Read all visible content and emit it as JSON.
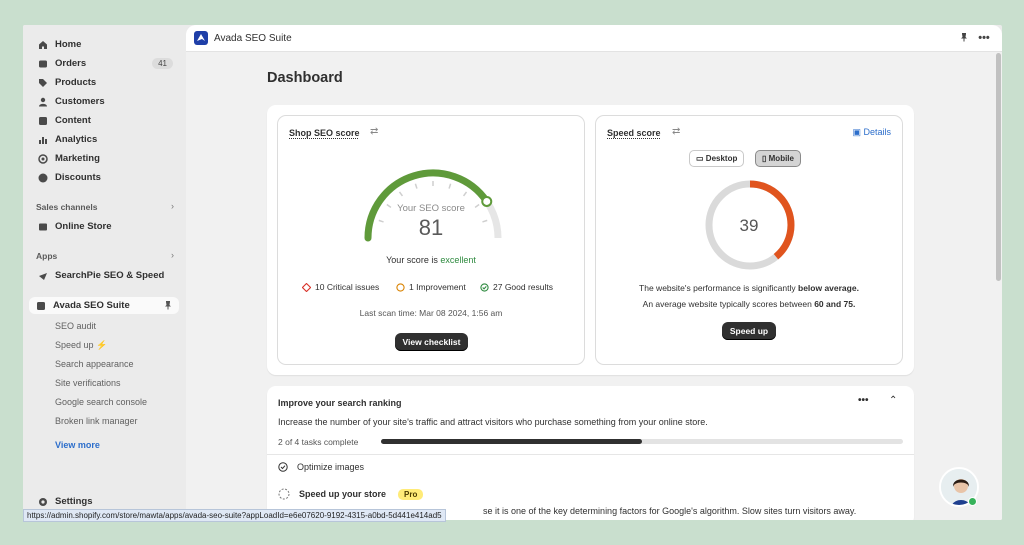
{
  "sidebar": {
    "items": [
      {
        "label": "Home",
        "icon": "home-icon"
      },
      {
        "label": "Orders",
        "icon": "orders-icon",
        "badge": "41"
      },
      {
        "label": "Products",
        "icon": "tag-icon"
      },
      {
        "label": "Customers",
        "icon": "person-icon"
      },
      {
        "label": "Content",
        "icon": "content-icon"
      },
      {
        "label": "Analytics",
        "icon": "bar-chart-icon"
      },
      {
        "label": "Marketing",
        "icon": "target-icon"
      },
      {
        "label": "Discounts",
        "icon": "discount-icon"
      }
    ],
    "sales_channels_title": "Sales channels",
    "online_store": "Online Store",
    "apps_title": "Apps",
    "searchpie": "SearchPie SEO & Speed",
    "active_app": "Avada SEO Suite",
    "sub_items": [
      "SEO audit",
      "Speed up ⚡",
      "Search appearance",
      "Site verifications",
      "Google search console",
      "Broken link manager"
    ],
    "view_more": "View more",
    "settings": "Settings"
  },
  "topbar": {
    "title": "Avada SEO Suite"
  },
  "page_title": "Dashboard",
  "seo": {
    "heading": "Shop SEO score",
    "gauge_label": "Your SEO score",
    "score": "81",
    "score_fraction": 0.81,
    "score_text_prefix": "Your score is",
    "score_text_value": "excellent",
    "critical": "10 Critical issues",
    "improvement": "1 Improvement",
    "good": "27 Good results",
    "last_scan": "Last scan time: Mar 08 2024, 1:56 am",
    "button": "View checklist"
  },
  "speed": {
    "heading": "Speed score",
    "details": "Details",
    "desktop": "Desktop",
    "mobile": "Mobile",
    "score": "39",
    "score_fraction": 0.39,
    "line1_prefix": "The website's performance is significantly",
    "line1_bold": "below average.",
    "line2_prefix": "An average website typically scores between",
    "line2_bold": "60 and 75.",
    "button": "Speed up"
  },
  "improve": {
    "title": "Improve your search ranking",
    "description": "Increase the number of your site's traffic and attract visitors who purchase something from your online store.",
    "tasks_complete": "2 of 4 tasks complete",
    "progress_fraction": 0.5,
    "task1": "Optimize images",
    "task2": "Speed up your store",
    "pro": "Pro",
    "task_desc": "se it is one of the key determining factors for Google's algorithm. Slow sites turn visitors away."
  },
  "status_url": "https://admin.shopify.com/store/mawta/apps/avada-seo-suite?appLoadId=e6e07620-9192-4315-a0bd-5d441e414ad5",
  "colors": {
    "seo_gauge": "#5f9a3a",
    "speed_gauge": "#e0541e",
    "link": "#2c6ecb",
    "excellent": "#2e8a3f"
  }
}
